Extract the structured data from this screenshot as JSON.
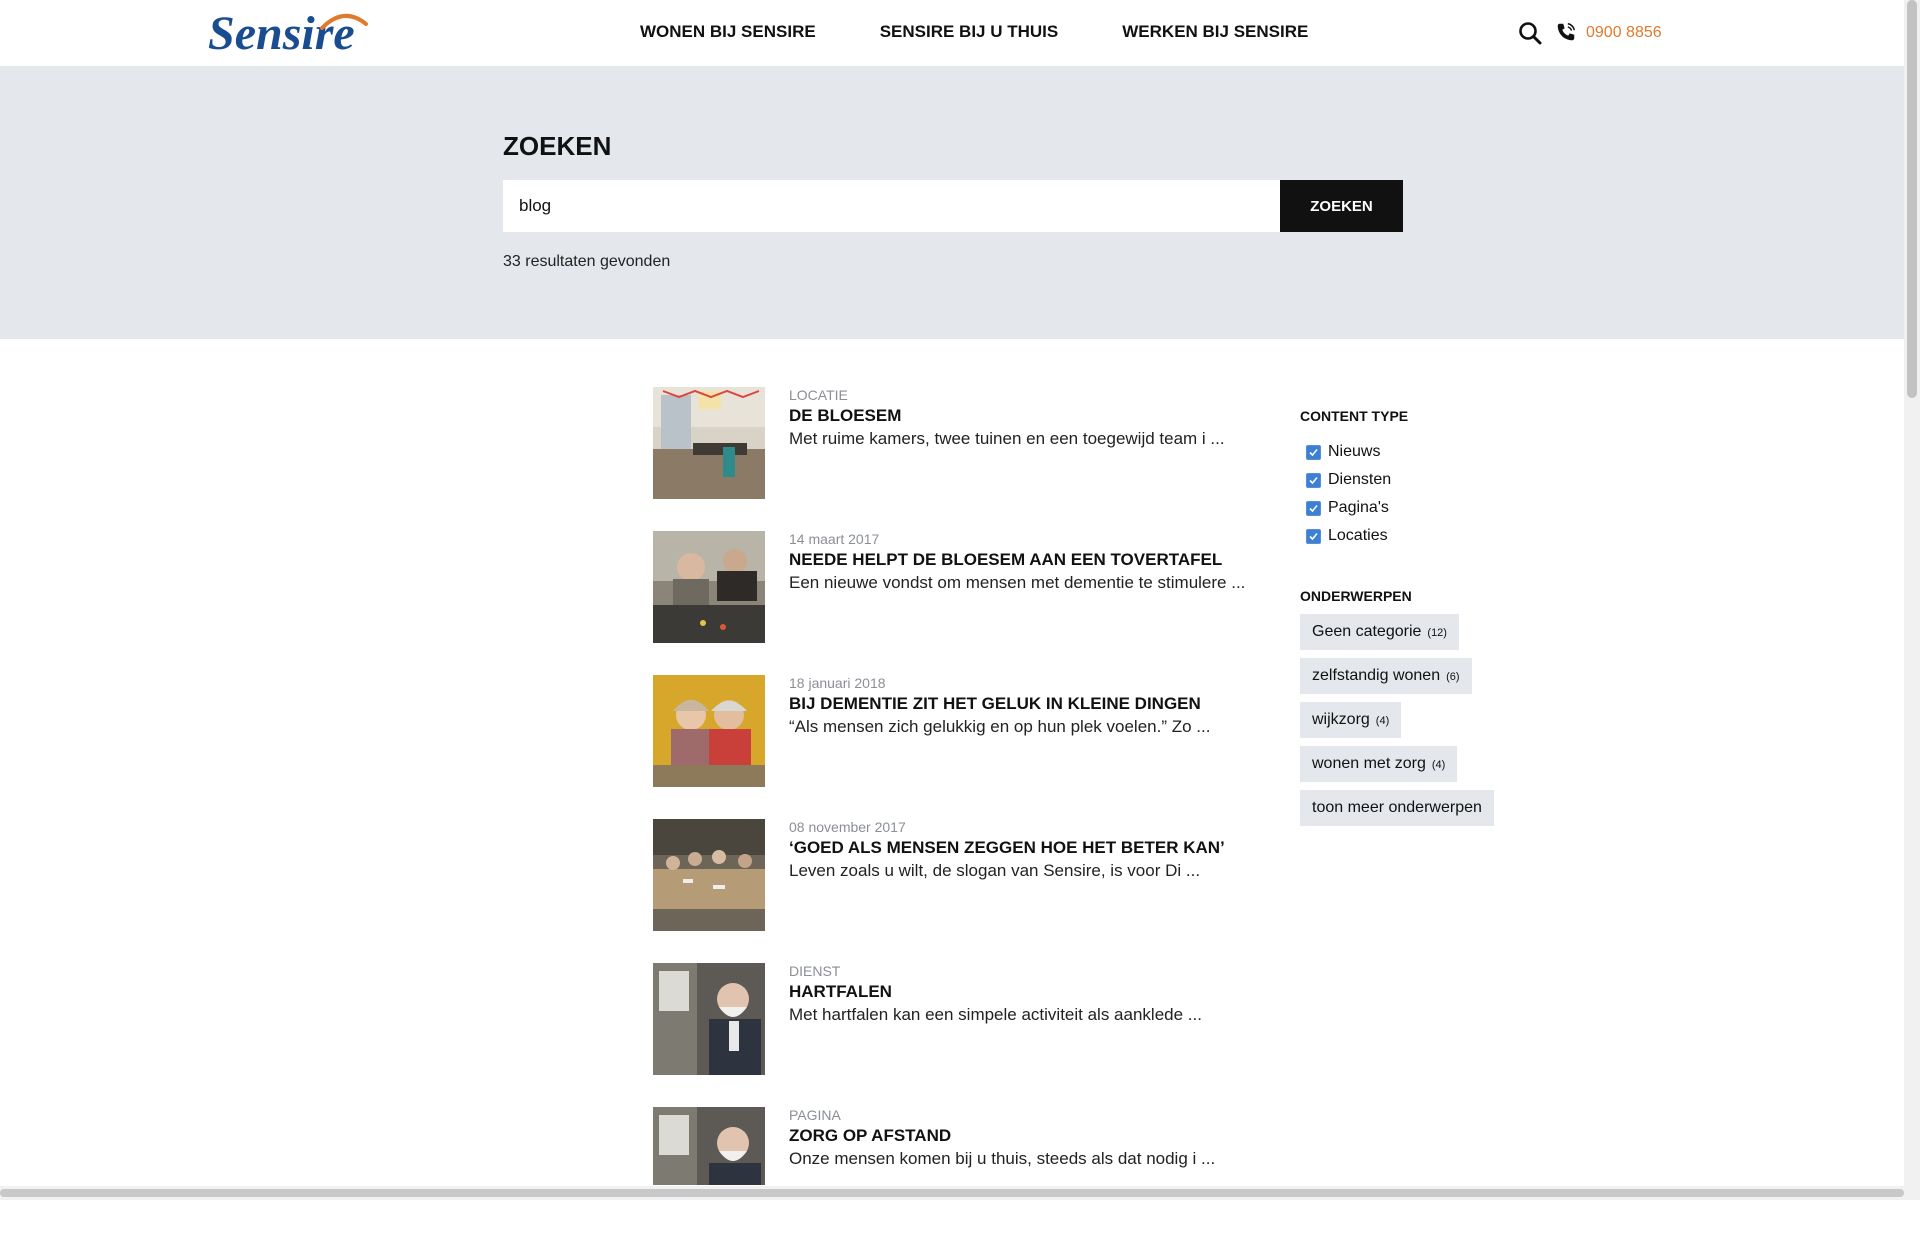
{
  "header": {
    "logo_text": "Sensire",
    "nav": [
      {
        "label": "WONEN BIJ SENSIRE"
      },
      {
        "label": "SENSIRE BIJ U THUIS"
      },
      {
        "label": "WERKEN BIJ SENSIRE"
      }
    ],
    "phone": "0900 8856",
    "search_icon": "search-icon",
    "phone_icon": "phone-icon",
    "accent_color": "#e07a2c",
    "brand_color": "#1a4d8f"
  },
  "search": {
    "title": "ZOEKEN",
    "value": "blog",
    "button_label": "ZOEKEN",
    "results_count": "33 resultaten gevonden"
  },
  "results": [
    {
      "meta": "LOCATIE",
      "title": "DE BLOESEM",
      "excerpt": "Met ruime kamers, twee tuinen en een toegewijd team i ..."
    },
    {
      "meta": "14 maart 2017",
      "title": "NEEDE HELPT DE BLOESEM AAN EEN TOVERTAFEL",
      "excerpt": "Een nieuwe vondst om mensen met dementie te stimulere ..."
    },
    {
      "meta": "18 januari 2018",
      "title": "BIJ DEMENTIE ZIT HET GELUK IN KLEINE DINGEN",
      "excerpt": "“Als mensen zich gelukkig en op hun plek voelen.” Zo ..."
    },
    {
      "meta": "08 november 2017",
      "title": "‘GOED ALS MENSEN ZEGGEN HOE HET BETER KAN’",
      "excerpt": "Leven zoals u wilt, de slogan van Sensire, is voor Di ..."
    },
    {
      "meta": "DIENST",
      "title": "HARTFALEN",
      "excerpt": "Met hartfalen kan een simpele activiteit als aanklede ..."
    },
    {
      "meta": "PAGINA",
      "title": "ZORG OP AFSTAND",
      "excerpt": "Onze mensen komen bij u thuis, steeds als dat nodig i ..."
    }
  ],
  "sidebar": {
    "content_type_heading": "CONTENT TYPE",
    "content_types": [
      {
        "label": "Nieuws",
        "checked": true
      },
      {
        "label": "Diensten",
        "checked": true
      },
      {
        "label": "Pagina's",
        "checked": true
      },
      {
        "label": "Locaties",
        "checked": true
      }
    ],
    "topics_heading": "ONDERWERPEN",
    "topics": [
      {
        "label": "Geen categorie",
        "count": "(12)"
      },
      {
        "label": "zelfstandig wonen",
        "count": "(6)"
      },
      {
        "label": "wijkzorg",
        "count": "(4)"
      },
      {
        "label": "wonen met zorg",
        "count": "(4)"
      }
    ],
    "more_topics": "toon meer onderwerpen"
  }
}
